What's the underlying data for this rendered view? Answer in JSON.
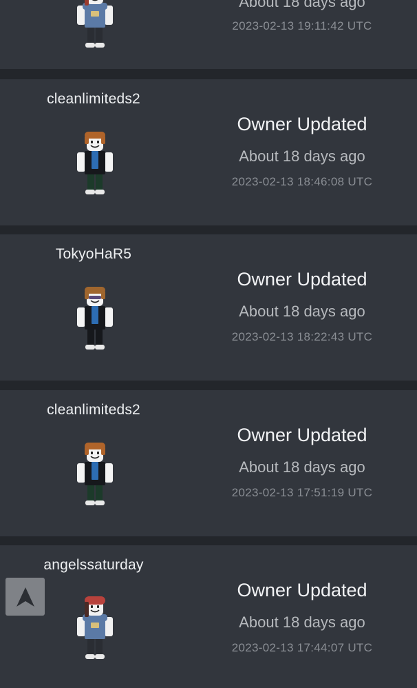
{
  "feed": {
    "entries": [
      {
        "username": "",
        "title": "",
        "relative": "About 18 days ago",
        "timestamp": "2023-02-13 19:11:42 UTC",
        "avatar": {
          "hair": "#9a3b2e",
          "hat": "#b8423c",
          "shirt": "#5b7aa6",
          "pants": "#2a2d33",
          "skin": "#f1f1f1",
          "style": "hoodie"
        }
      },
      {
        "username": "cleanlimiteds2",
        "title": "Owner Updated",
        "relative": "About 18 days ago",
        "timestamp": "2023-02-13 18:46:08 UTC",
        "avatar": {
          "hair": "#b0642a",
          "shirt": "#16181c",
          "inner": "#2d6db3",
          "pants": "#1c3a2a",
          "skin": "#f4f4f4",
          "style": "jacket"
        }
      },
      {
        "username": "TokyoHaR5",
        "title": "Owner Updated",
        "relative": "About 18 days ago",
        "timestamp": "2023-02-13 18:22:43 UTC",
        "avatar": {
          "hair": "#a0662e",
          "shirt": "#16181c",
          "inner": "#2d6db3",
          "pants": "#16181c",
          "skin": "#f4f4f4",
          "style": "shades"
        }
      },
      {
        "username": "cleanlimiteds2",
        "title": "Owner Updated",
        "relative": "About 18 days ago",
        "timestamp": "2023-02-13 17:51:19 UTC",
        "avatar": {
          "hair": "#b0642a",
          "shirt": "#16181c",
          "inner": "#2d6db3",
          "pants": "#1c3a2a",
          "skin": "#f4f4f4",
          "style": "jacket"
        }
      },
      {
        "username": "angelssaturday",
        "title": "Owner Updated",
        "relative": "About 18 days ago",
        "timestamp": "2023-02-13 17:44:07 UTC",
        "avatar": {
          "hair": "#4a2a26",
          "hat": "#b8423c",
          "shirt": "#5b7aa6",
          "pants": "#2a2d33",
          "skin": "#f1f1f1",
          "style": "hoodie"
        }
      }
    ]
  },
  "scroll_top": {
    "icon": "arrow-up-icon"
  },
  "colors": {
    "page_bg": "#23262b",
    "card_bg": "#32363d"
  }
}
